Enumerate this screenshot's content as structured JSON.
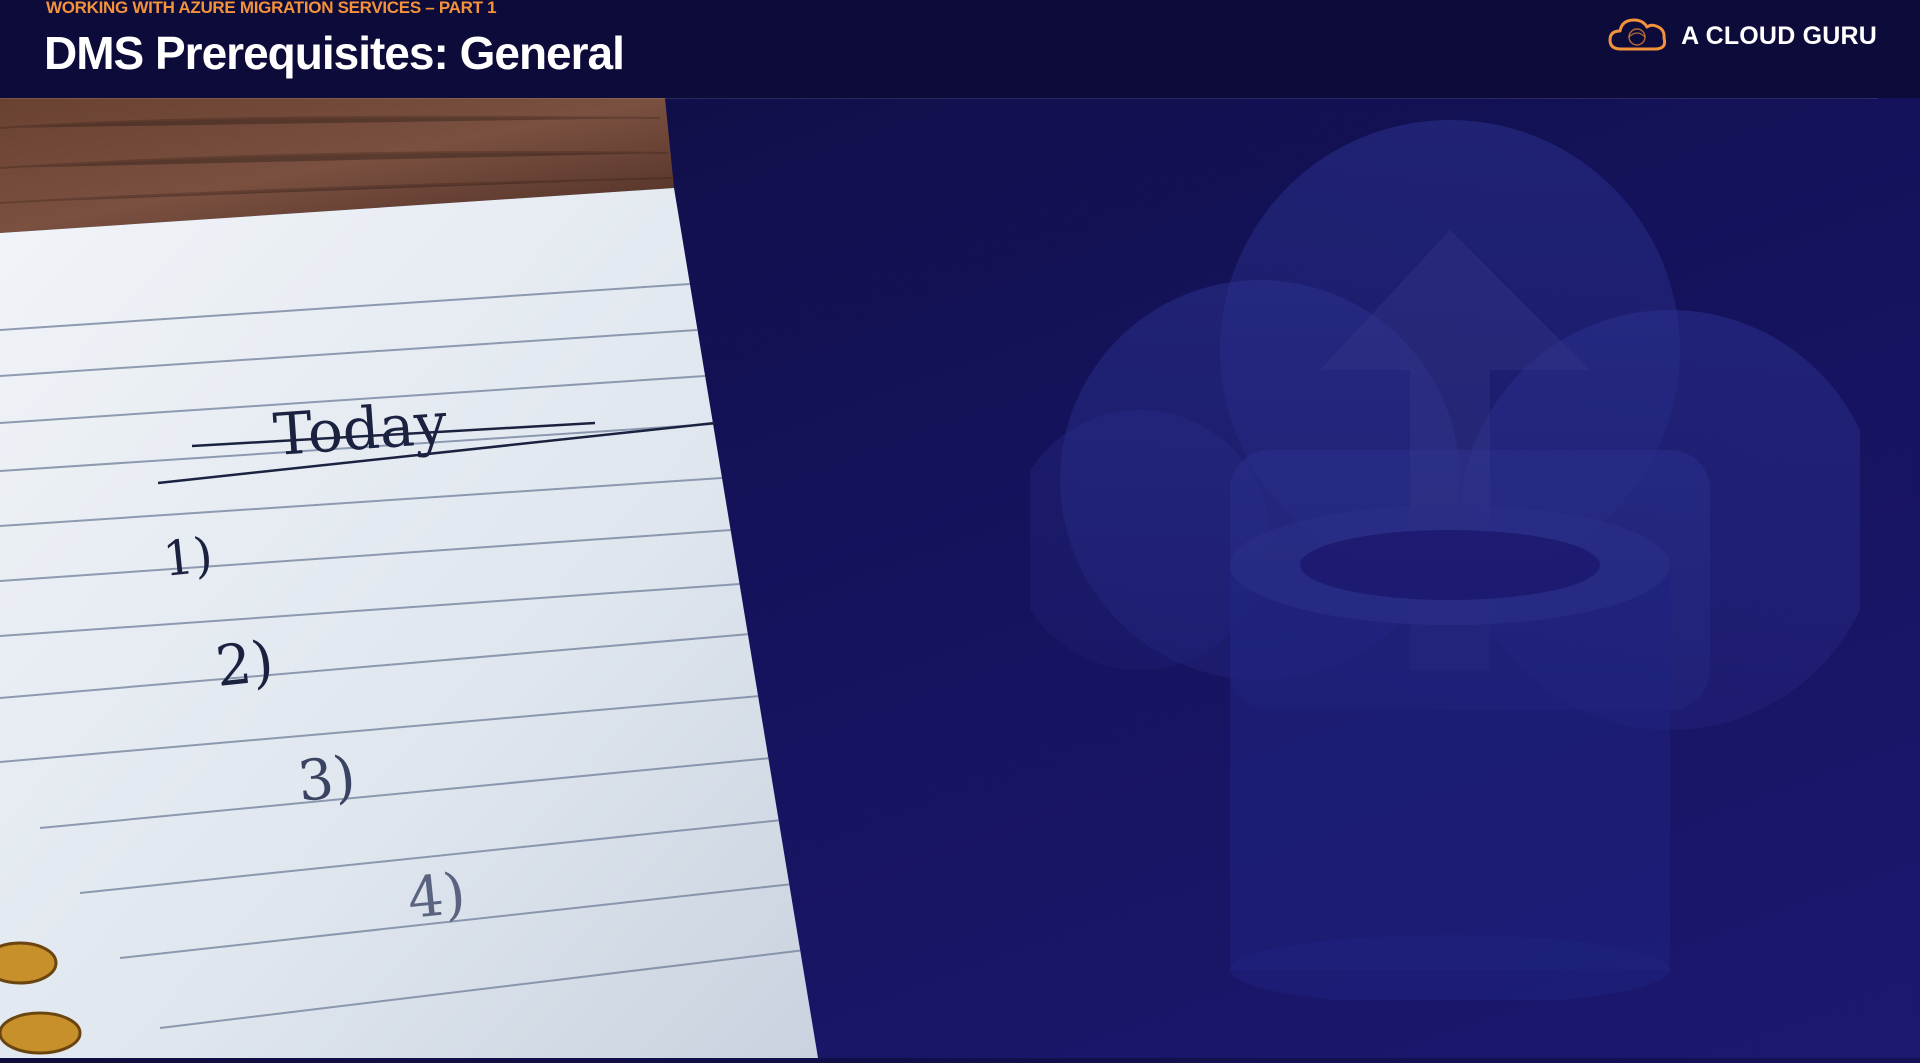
{
  "header": {
    "course_label": "WORKING WITH AZURE MIGRATION SERVICES – PART 1",
    "title": "DMS Prerequisites:  General",
    "brand_name": "A CLOUD GURU",
    "brand_icon": "cloud-logo-icon"
  },
  "notebook": {
    "heading": "Today",
    "items": [
      "1)",
      "2)",
      "3)",
      "4)"
    ]
  },
  "watermark_icon": "cloud-database-upload-icon",
  "colors": {
    "accent_orange": "#f3923b",
    "header_bg": "#0d0b3a",
    "slide_bg": "#16135f"
  }
}
